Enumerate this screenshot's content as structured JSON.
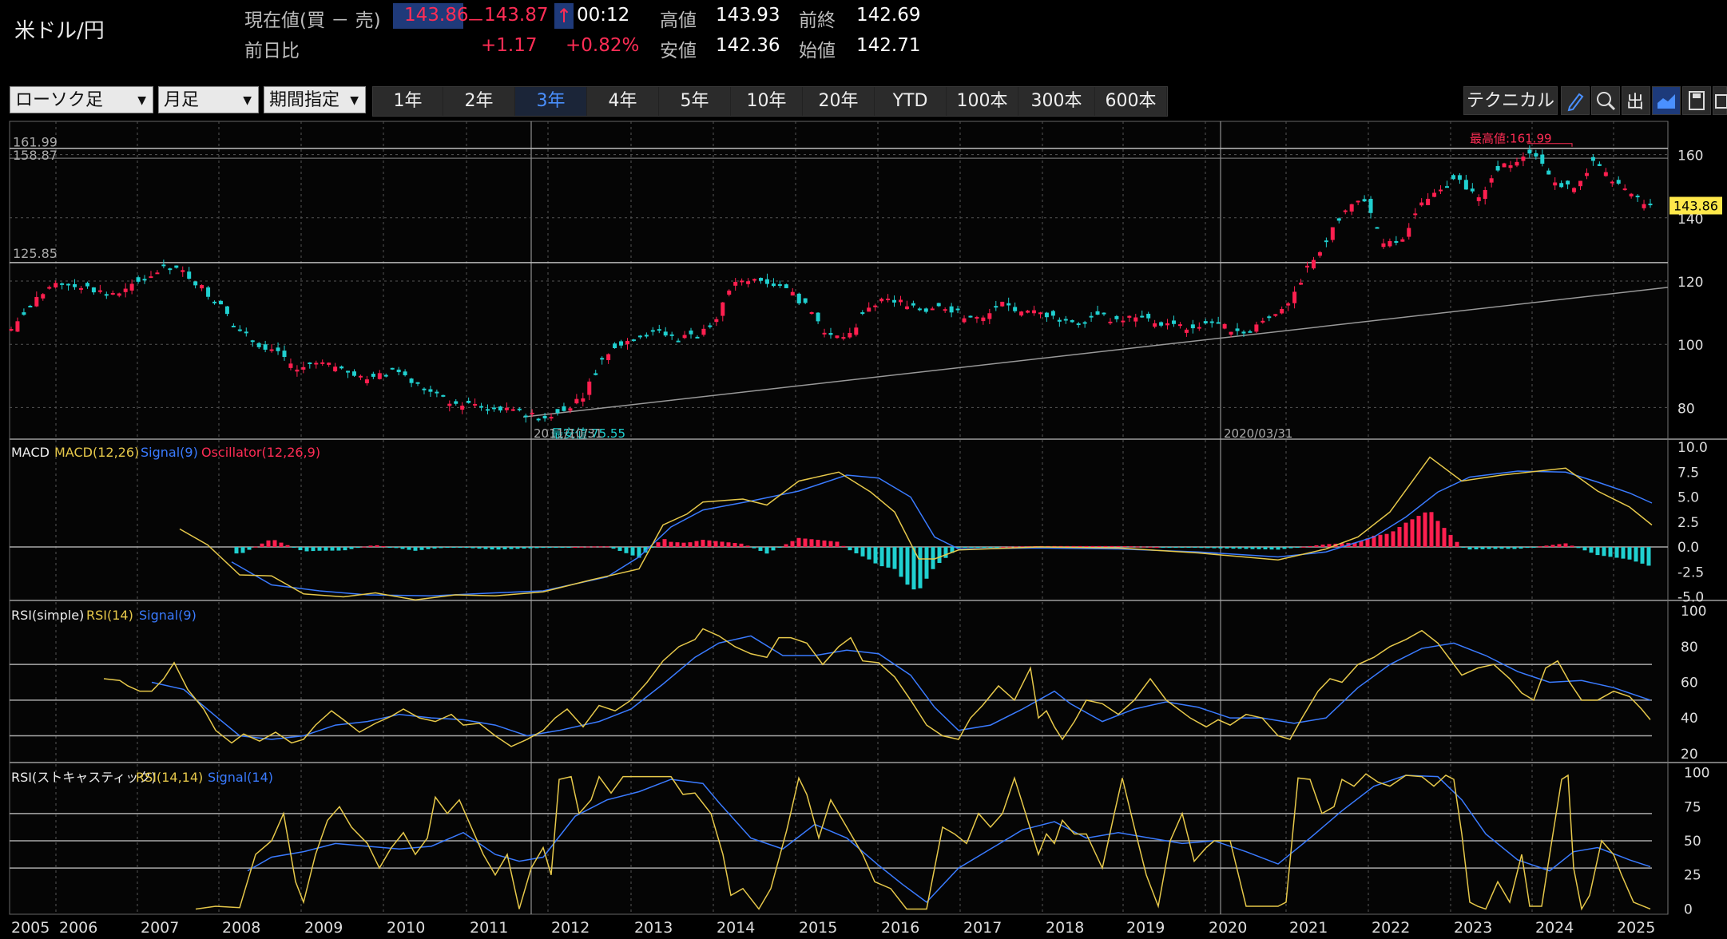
{
  "header": {
    "symbol": "米ドル/円",
    "current_label": "現在値(買 － 売)",
    "bid": "143.86",
    "dash": "－",
    "ask": "143.87",
    "arrow": "↑",
    "time": "00:12",
    "change_label": "前日比",
    "change": "+1.17",
    "change_pct": "+0.82%",
    "high_label": "高値",
    "high": "143.93",
    "low_label": "安値",
    "low": "142.36",
    "prev_close_label": "前終",
    "prev_close": "142.69",
    "open_label": "始値",
    "open": "142.71"
  },
  "toolbar": {
    "chart_type": "ローソク足",
    "interval": "月足",
    "range_mode": "期間指定",
    "periods": [
      "1年",
      "2年",
      "3年",
      "4年",
      "5年",
      "10年",
      "20年",
      "YTD",
      "100本",
      "300本",
      "600本"
    ],
    "active_period": "3年",
    "technical_label": "テクニカル",
    "icons": [
      "pen-icon",
      "zoom-icon",
      "export-icon",
      "area-chart-icon",
      "save-icon",
      "window-icon"
    ]
  },
  "colors": {
    "up": "#ff1f4f",
    "down": "#20d0d0",
    "macd": "#e6c84a",
    "signal": "#3a7bff",
    "grid": "#555555"
  },
  "chart_data": {
    "type": "candlestick",
    "x_years": [
      "2005",
      "2006",
      "2007",
      "2008",
      "2009",
      "2010",
      "2011",
      "2012",
      "2013",
      "2014",
      "2015",
      "2016",
      "2017",
      "2018",
      "2019",
      "2020",
      "2021",
      "2022",
      "2023",
      "2024",
      "2025"
    ],
    "price": {
      "ylim": [
        70,
        170
      ],
      "y_ticks": [
        "160",
        "140",
        "120",
        "100",
        "80"
      ],
      "last_price_label": "143.86",
      "ref_lines": [
        "161.99",
        "158.87",
        "125.85"
      ],
      "high_annotation": "最高値:161.99",
      "low_annotation": "最安値:75.55",
      "date_labels": [
        "2011/10/31",
        "2020/03/31"
      ],
      "closes": [
        104,
        112,
        118,
        119,
        118,
        116,
        117,
        121,
        124,
        123,
        118,
        112,
        104,
        100,
        98,
        92,
        94,
        93,
        90,
        89,
        92,
        88,
        85,
        82,
        81,
        80,
        79,
        78,
        77,
        79,
        84,
        95,
        100,
        103,
        104,
        102,
        103,
        109,
        120,
        121,
        119,
        116,
        110,
        102,
        103,
        112,
        114,
        113,
        111,
        112,
        109,
        108,
        113,
        110,
        110,
        108,
        107,
        110,
        107,
        109,
        107,
        106,
        105,
        107,
        105,
        104,
        109,
        113,
        124,
        133,
        142,
        146,
        131,
        134,
        144,
        150,
        152,
        146,
        156,
        158,
        160,
        151,
        150,
        157,
        152,
        147,
        144
      ]
    },
    "macd": {
      "label": "MACD",
      "macd_label": "MACD(12,26)",
      "signal_label": "Signal(9)",
      "osc_label": "Oscillator(12,26,9)",
      "ylim": [
        -6,
        10
      ],
      "y_ticks": [
        "10.0",
        "7.5",
        "5.0",
        "2.5",
        "0.0",
        "-2.5",
        "-5.0"
      ]
    },
    "rsi": {
      "label": "RSI(simple)",
      "rsi_label": "RSI(14)",
      "signal_label": "Signal(9)",
      "ylim": [
        15,
        105
      ],
      "y_ticks": [
        "100",
        "80",
        "60",
        "40",
        "20"
      ]
    },
    "stoch": {
      "label": "RSI(ストキャスティック)",
      "rsi_label": "RSI(14,14)",
      "signal_label": "Signal(14)",
      "ylim": [
        -5,
        105
      ],
      "y_ticks": [
        "100",
        "75",
        "50",
        "25",
        "0"
      ]
    }
  }
}
